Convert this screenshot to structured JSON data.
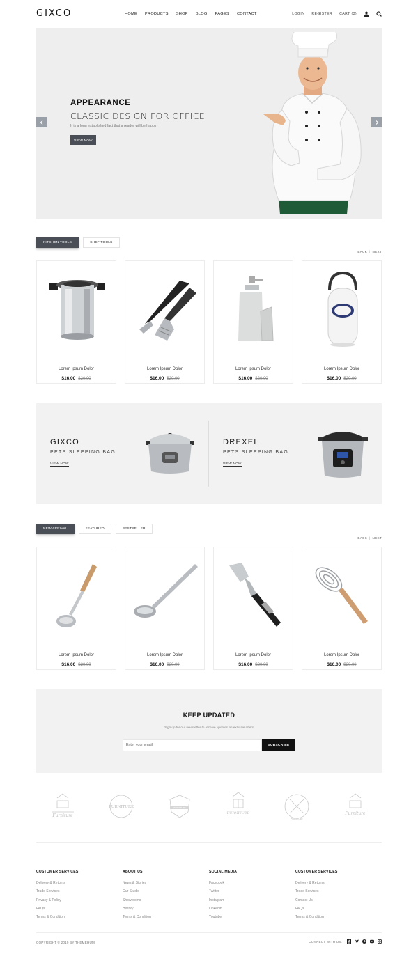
{
  "header": {
    "logo": "GIXCO",
    "nav": [
      "HOME",
      "PRODUCTS",
      "SHOP",
      "BLOG",
      "PAGES",
      "CONTACT"
    ],
    "login": "LOGIN",
    "register": "REGISTER",
    "cart": "CART (3)"
  },
  "hero": {
    "kicker": "APPEARANCE",
    "title": "CLASSIC DESIGN FOR OFFICE",
    "subtitle": "It is a long established fact that a reader will be happy",
    "button": "VIEW NOW"
  },
  "section1": {
    "tabs": [
      "KITCHEN TOOLS",
      "CHEF TOOLS"
    ],
    "pager": {
      "back": "BACK",
      "next": "NEXT"
    },
    "products": [
      {
        "name": "Lorem Ipsum Dolor",
        "price": "$16.00",
        "old_price": "$20.00",
        "icon": "pot-icon"
      },
      {
        "name": "Lorem Ipsum Dolor",
        "price": "$16.00",
        "old_price": "$20.00",
        "icon": "bbq-tools-icon"
      },
      {
        "name": "Lorem Ipsum Dolor",
        "price": "$16.00",
        "old_price": "$20.00",
        "icon": "soap-dispenser-icon"
      },
      {
        "name": "Lorem Ipsum Dolor",
        "price": "$16.00",
        "old_price": "$20.00",
        "icon": "lantern-icon"
      }
    ]
  },
  "banner": {
    "left": {
      "title": "GIXCO",
      "subtitle": "PETS SLEEPING BAG",
      "link": "VIEW NOW"
    },
    "right": {
      "title": "DREXEL",
      "subtitle": "PETS SLEEPING BAG",
      "link": "VIEW NOW"
    }
  },
  "section2": {
    "tabs": [
      "NEW ARRIVAL",
      "FEATURED",
      "BESTSELLER"
    ],
    "pager": {
      "back": "BACK",
      "next": "NEXT"
    },
    "products": [
      {
        "name": "Lorem Ipsum Dolor",
        "price": "$16.00",
        "old_price": "$20.00",
        "icon": "wooden-ladle-icon"
      },
      {
        "name": "Lorem Ipsum Dolor",
        "price": "$16.00",
        "old_price": "$20.00",
        "icon": "steel-ladle-icon"
      },
      {
        "name": "Lorem Ipsum Dolor",
        "price": "$16.00",
        "old_price": "$20.00",
        "icon": "spatula-icon"
      },
      {
        "name": "Lorem Ipsum Dolor",
        "price": "$16.00",
        "old_price": "$20.00",
        "icon": "whisk-icon"
      }
    ]
  },
  "newsletter": {
    "title": "KEEP UPDATED",
    "subtitle": "Sign up for our newsletter to receive updates an exlusive offers",
    "placeholder": "Enter your email",
    "button": "SUBSCRIBE"
  },
  "brands": [
    "Furniture",
    "FURNITURE",
    "FURNITURE",
    "FURNITURE",
    "FURNITURE",
    "Furniture"
  ],
  "footer": {
    "columns": [
      {
        "title": "CUSTOMER SERVICES",
        "links": [
          "Delivery & Returns",
          "Trade Services",
          "Privacy & Policy",
          "FAQs",
          "Terms & Condition"
        ]
      },
      {
        "title": "ABOUT US",
        "links": [
          "News & Stories",
          "Our Studio",
          "Showrooms",
          "History",
          "Terms & Condition"
        ]
      },
      {
        "title": "SOCIAL MEDIA",
        "links": [
          "Facebook",
          "Twitter",
          "Instagram",
          "Linkedin",
          "Youtube"
        ]
      },
      {
        "title": "CUSTOMER SERVICES",
        "links": [
          "Delivery & Returns",
          "Trade Services",
          "Contact Us",
          "FAQs",
          "Terms & Condition"
        ]
      }
    ],
    "copyright": "COPYRIGHT © 2019 BY THEMEHUM",
    "connect": "CONNECT WITH US:",
    "social_icons": [
      "facebook-icon",
      "twitter-icon",
      "pinterest-icon",
      "youtube-icon",
      "instagram-icon"
    ]
  },
  "colors": {
    "accent_dark": "#4a4f57",
    "panel_bg": "#eeeeee",
    "chef_pants": "#1e5b36"
  }
}
